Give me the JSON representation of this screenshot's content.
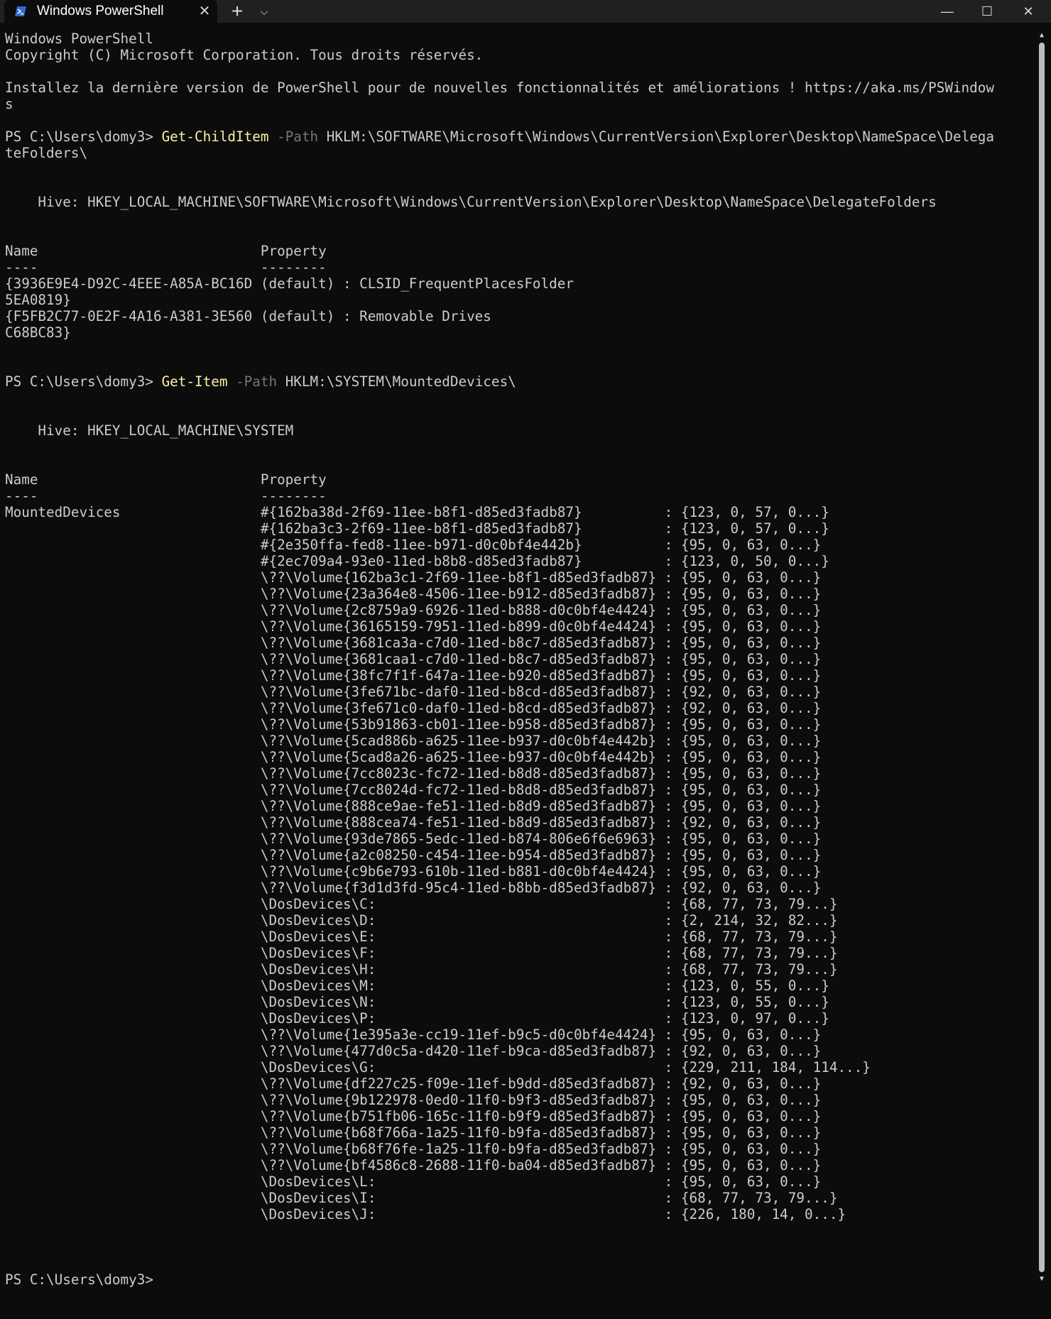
{
  "window": {
    "tab_title": "Windows PowerShell",
    "tab_icon": "powershell-icon",
    "tab_close_glyph": "✕",
    "new_tab_glyph": "+",
    "dropdown_glyph": "⌵",
    "minimize_glyph": "—",
    "maximize_glyph": "☐",
    "close_glyph": "✕"
  },
  "colors": {
    "background": "#0c0c0c",
    "text": "#cccccc",
    "command": "#f9f1a5",
    "parameter": "#767676",
    "titlebar": "#202020"
  },
  "terminal": {
    "prompt": "PS C:\\Users\\domy3> ",
    "lines": [
      "Windows PowerShell",
      "Copyright (C) Microsoft Corporation. Tous droits réservés.",
      "",
      "Installez la dernière version de PowerShell pour de nouvelles fonctionnalités et améliorations ! https://aka.ms/PSWindow",
      "s",
      "",
      "",
      "teFolders\\",
      "",
      "",
      "    Hive: HKEY_LOCAL_MACHINE\\SOFTWARE\\Microsoft\\Windows\\CurrentVersion\\Explorer\\Desktop\\NameSpace\\DelegateFolders",
      "",
      "",
      "Name                           Property",
      "----                           --------",
      "{3936E9E4-D92C-4EEE-A85A-BC16D (default) : CLSID_FrequentPlacesFolder",
      "5EA0819}",
      "{F5FB2C77-0E2F-4A16-A381-3E560 (default) : Removable Drives",
      "C68BC83}",
      "",
      "",
      "",
      "",
      "",
      "    Hive: HKEY_LOCAL_MACHINE\\SYSTEM",
      "",
      "",
      "Name                           Property",
      "----                           --------",
      "MountedDevices                 #{162ba38d-2f69-11ee-b8f1-d85ed3fadb87}          : {123, 0, 57, 0...}",
      "                               #{162ba3c3-2f69-11ee-b8f1-d85ed3fadb87}          : {123, 0, 57, 0...}",
      "                               #{2e350ffa-fed8-11ee-b971-d0c0bf4e442b}          : {95, 0, 63, 0...}",
      "                               #{2ec709a4-93e0-11ed-b8b8-d85ed3fadb87}          : {123, 0, 50, 0...}",
      "                               \\??\\Volume{162ba3c1-2f69-11ee-b8f1-d85ed3fadb87} : {95, 0, 63, 0...}",
      "                               \\??\\Volume{23a364e8-4506-11ee-b912-d85ed3fadb87} : {95, 0, 63, 0...}",
      "                               \\??\\Volume{2c8759a9-6926-11ed-b888-d0c0bf4e4424} : {95, 0, 63, 0...}",
      "                               \\??\\Volume{36165159-7951-11ed-b899-d0c0bf4e4424} : {95, 0, 63, 0...}",
      "                               \\??\\Volume{3681ca3a-c7d0-11ed-b8c7-d85ed3fadb87} : {95, 0, 63, 0...}",
      "                               \\??\\Volume{3681caa1-c7d0-11ed-b8c7-d85ed3fadb87} : {95, 0, 63, 0...}",
      "                               \\??\\Volume{38fc7f1f-647a-11ee-b920-d85ed3fadb87} : {95, 0, 63, 0...}",
      "                               \\??\\Volume{3fe671bc-daf0-11ed-b8cd-d85ed3fadb87} : {92, 0, 63, 0...}",
      "                               \\??\\Volume{3fe671c0-daf0-11ed-b8cd-d85ed3fadb87} : {92, 0, 63, 0...}",
      "                               \\??\\Volume{53b91863-cb01-11ee-b958-d85ed3fadb87} : {95, 0, 63, 0...}",
      "                               \\??\\Volume{5cad886b-a625-11ee-b937-d0c0bf4e442b} : {95, 0, 63, 0...}",
      "                               \\??\\Volume{5cad8a26-a625-11ee-b937-d0c0bf4e442b} : {95, 0, 63, 0...}",
      "                               \\??\\Volume{7cc8023c-fc72-11ed-b8d8-d85ed3fadb87} : {95, 0, 63, 0...}",
      "                               \\??\\Volume{7cc8024d-fc72-11ed-b8d8-d85ed3fadb87} : {95, 0, 63, 0...}",
      "                               \\??\\Volume{888ce9ae-fe51-11ed-b8d9-d85ed3fadb87} : {95, 0, 63, 0...}",
      "                               \\??\\Volume{888cea74-fe51-11ed-b8d9-d85ed3fadb87} : {92, 0, 63, 0...}",
      "                               \\??\\Volume{93de7865-5edc-11ed-b874-806e6f6e6963} : {95, 0, 63, 0...}",
      "                               \\??\\Volume{a2c08250-c454-11ee-b954-d85ed3fadb87} : {95, 0, 63, 0...}",
      "                               \\??\\Volume{c9b6e793-610b-11ed-b881-d0c0bf4e4424} : {95, 0, 63, 0...}",
      "                               \\??\\Volume{f3d1d3fd-95c4-11ed-b8bb-d85ed3fadb87} : {92, 0, 63, 0...}",
      "                               \\DosDevices\\C:                                   : {68, 77, 73, 79...}",
      "                               \\DosDevices\\D:                                   : {2, 214, 32, 82...}",
      "                               \\DosDevices\\E:                                   : {68, 77, 73, 79...}",
      "                               \\DosDevices\\F:                                   : {68, 77, 73, 79...}",
      "                               \\DosDevices\\H:                                   : {68, 77, 73, 79...}",
      "                               \\DosDevices\\M:                                   : {123, 0, 55, 0...}",
      "                               \\DosDevices\\N:                                   : {123, 0, 55, 0...}",
      "                               \\DosDevices\\P:                                   : {123, 0, 97, 0...}",
      "                               \\??\\Volume{1e395a3e-cc19-11ef-b9c5-d0c0bf4e4424} : {95, 0, 63, 0...}",
      "                               \\??\\Volume{477d0c5a-d420-11ef-b9ca-d85ed3fadb87} : {92, 0, 63, 0...}",
      "                               \\DosDevices\\G:                                   : {229, 211, 184, 114...}",
      "                               \\??\\Volume{df227c25-f09e-11ef-b9dd-d85ed3fadb87} : {92, 0, 63, 0...}",
      "                               \\??\\Volume{9b122978-0ed0-11f0-b9f3-d85ed3fadb87} : {95, 0, 63, 0...}",
      "                               \\??\\Volume{b751fb06-165c-11f0-b9f9-d85ed3fadb87} : {95, 0, 63, 0...}",
      "                               \\??\\Volume{b68f766a-1a25-11f0-b9fa-d85ed3fadb87} : {95, 0, 63, 0...}",
      "                               \\??\\Volume{b68f76fe-1a25-11f0-b9fa-d85ed3fadb87} : {95, 0, 63, 0...}",
      "                               \\??\\Volume{bf4586c8-2688-11f0-ba04-d85ed3fadb87} : {95, 0, 63, 0...}",
      "                               \\DosDevices\\L:                                   : {95, 0, 63, 0...}",
      "                               \\DosDevices\\I:                                   : {68, 77, 73, 79...}",
      "                               \\DosDevices\\J:                                   : {226, 180, 14, 0...}",
      "",
      "",
      ""
    ],
    "command1": {
      "cmdlet": "Get-ChildItem",
      "param": " -Path",
      "arg": " HKLM:\\SOFTWARE\\Microsoft\\Windows\\CurrentVersion\\Explorer\\Desktop\\NameSpace\\Delega"
    },
    "command2": {
      "cmdlet": "Get-Item",
      "param": " -Path",
      "arg": " HKLM:\\SYSTEM\\MountedDevices\\"
    }
  }
}
